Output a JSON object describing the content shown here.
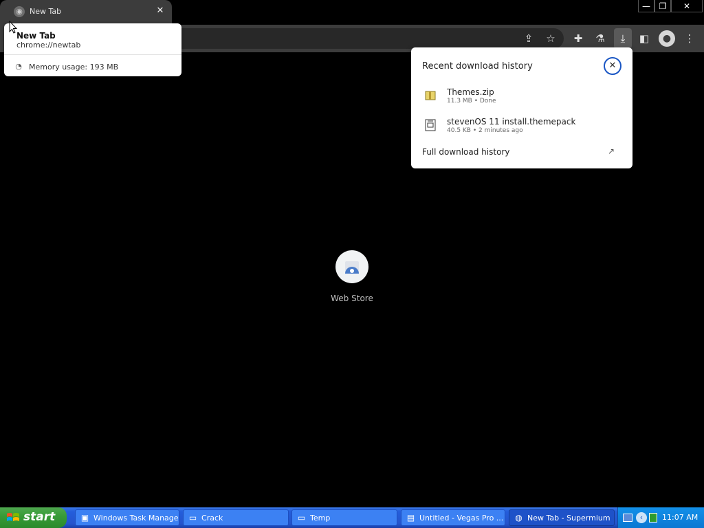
{
  "browser": {
    "tab_title": "New Tab",
    "tab_close": "✕",
    "window_controls": {
      "minimize": "—",
      "maximize": "❐",
      "close": "✕"
    }
  },
  "hover_card": {
    "title": "New Tab",
    "url": "chrome://newtab",
    "memory": "Memory usage: 193 MB"
  },
  "downloads": {
    "title": "Recent download history",
    "items": [
      {
        "name": "Themes.zip",
        "meta": "11.3 MB • Done",
        "icon": "zip-folder-icon"
      },
      {
        "name": "stevenOS 11 install.themepack",
        "meta": "40.5 KB • 2 minutes ago",
        "icon": "themepack-file-icon"
      }
    ],
    "full_history": "Full download history"
  },
  "ntp": {
    "shortcut_label": "Web Store"
  },
  "taskbar": {
    "start_label": "start",
    "tasks": [
      {
        "label": "Windows Task Manager",
        "icon": "task-manager-icon"
      },
      {
        "label": "Crack",
        "icon": "folder-icon"
      },
      {
        "label": "Temp",
        "icon": "folder-icon"
      },
      {
        "label": "Untitled - Vegas Pro ...",
        "icon": "vegas-icon"
      },
      {
        "label": "New Tab - Supermium",
        "icon": "supermium-icon",
        "active": true
      }
    ],
    "clock": "11:07 AM"
  },
  "colors": {
    "taskbar_blue": "#245edb",
    "start_green": "#389c38",
    "accent_blue": "#1a56c4"
  }
}
